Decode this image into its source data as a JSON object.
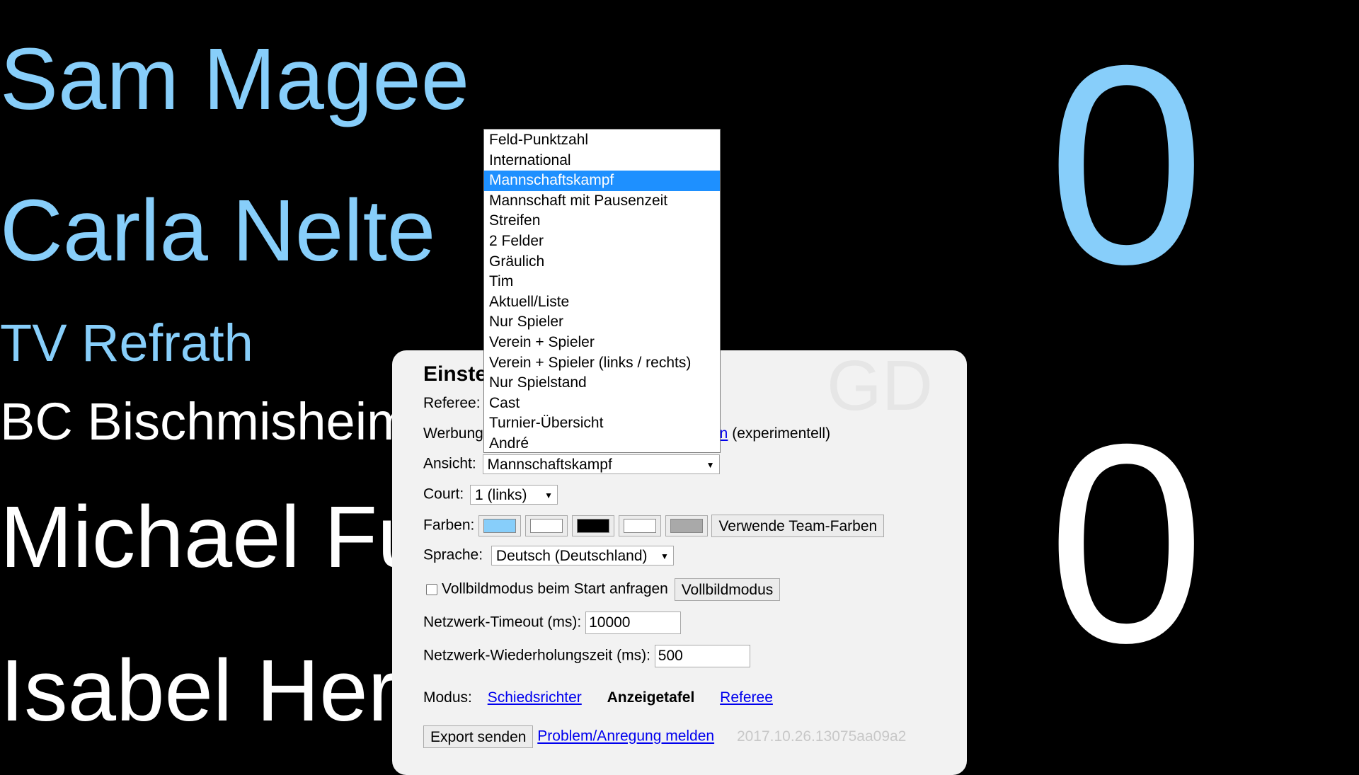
{
  "scoreboard": {
    "team1_player1": "Sam Magee",
    "team1_player2": "Carla Nelte",
    "team1_name": "TV Refrath",
    "team2_name": "BC Bischmisheim",
    "team2_player1": "Michael Fuchs",
    "team2_player2": "Isabel Herttrich",
    "score_team1": "0",
    "score_team2": "0",
    "discipline": "GD",
    "colors": {
      "team1": "#87cefa",
      "team2": "#ffffff",
      "background": "#000000"
    }
  },
  "settings": {
    "title": "Einstellungen",
    "referee_label": "Referee:",
    "werbung_label": "Werbung",
    "werbung_link": "ren",
    "werbung_note": "(experimentell)",
    "ansicht_label": "Ansicht:",
    "ansicht_value": "Mannschaftskampf",
    "court_label": "Court:",
    "court_value": "1 (links)",
    "farben_label": "Farben:",
    "farben_swatches": [
      "#87cefa",
      "#ffffff",
      "#000000",
      "#ffffff",
      "#a9a9a9"
    ],
    "team_colors_button": "Verwende Team-Farben",
    "sprache_label": "Sprache:",
    "sprache_value": "Deutsch (Deutschland)",
    "fullscreen_checkbox_label": "Vollbildmodus beim Start anfragen",
    "fullscreen_button": "Vollbildmodus",
    "timeout_label": "Netzwerk-Timeout (ms):",
    "timeout_value": "10000",
    "retry_label": "Netzwerk-Wiederholungszeit (ms):",
    "retry_value": "500",
    "modus_label": "Modus:",
    "modus_schiedsrichter": "Schiedsrichter",
    "modus_anzeigetafel": "Anzeigetafel",
    "modus_referee": "Referee",
    "export_button": "Export senden",
    "report_link": "Problem/Anregung melden",
    "version": "2017.10.26.13075aa09a2"
  },
  "dropdown": {
    "options": [
      "Feld-Punktzahl",
      "International",
      "Mannschaftskampf",
      "Mannschaft mit Pausenzeit",
      "Streifen",
      "2 Felder",
      "Gräulich",
      "Tim",
      "Aktuell/Liste",
      "Nur Spieler",
      "Verein + Spieler",
      "Verein + Spieler (links / rechts)",
      "Nur Spielstand",
      "Cast",
      "Turnier-Übersicht",
      "André"
    ],
    "selected": "Mannschaftskampf"
  }
}
